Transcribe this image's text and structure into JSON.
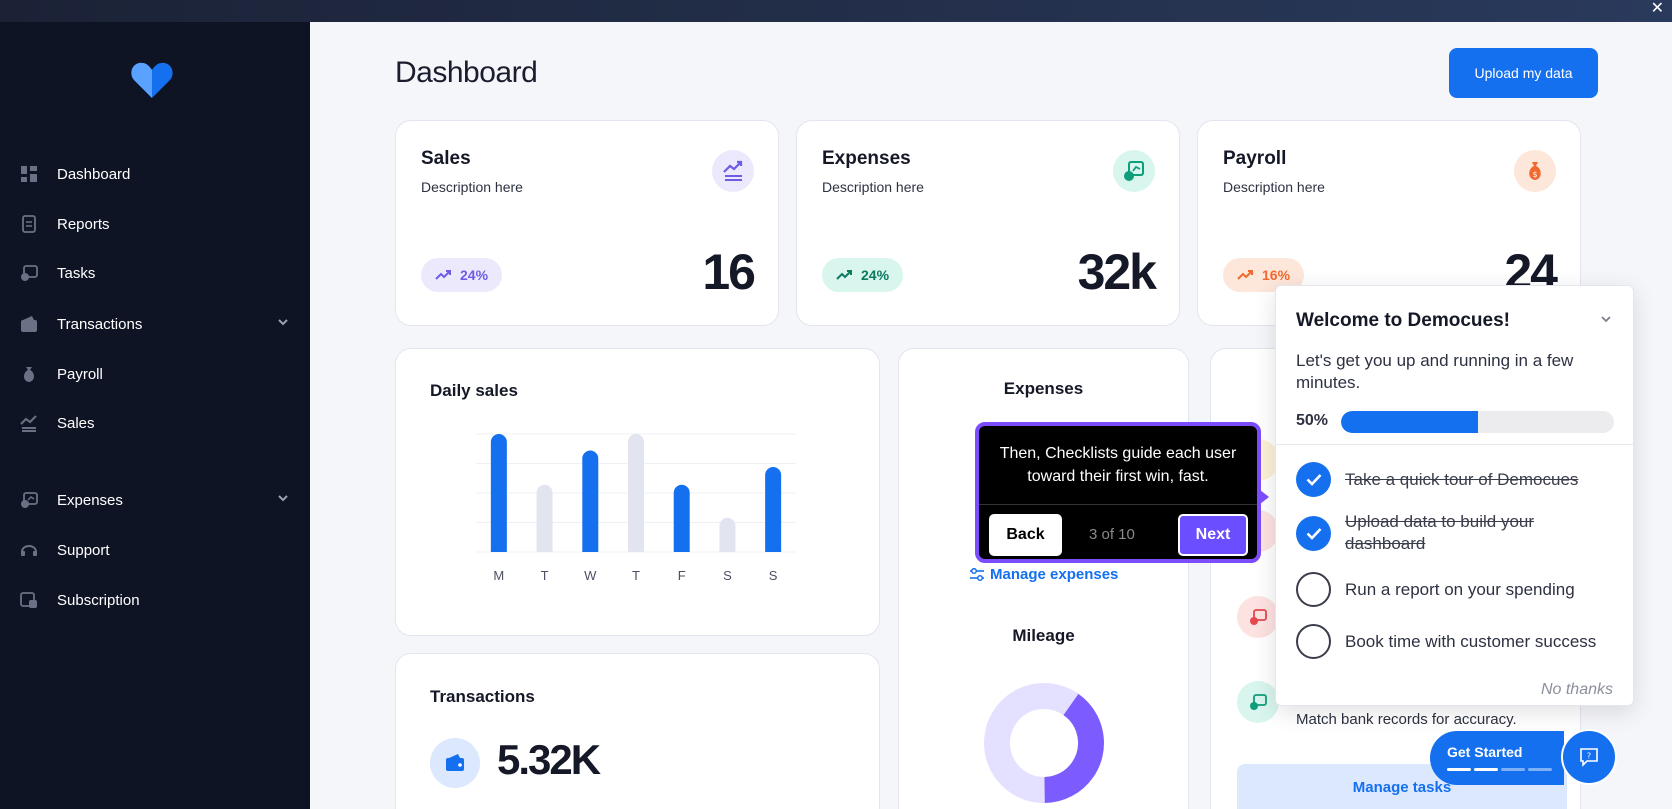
{
  "window": {
    "close_glyph": "✕"
  },
  "sidebar": {
    "logo": "heart-logo",
    "items": [
      {
        "label": "Dashboard",
        "icon": "dashboard-icon"
      },
      {
        "label": "Reports",
        "icon": "document-icon"
      },
      {
        "label": "Tasks",
        "icon": "tasks-icon"
      },
      {
        "label": "Transactions",
        "icon": "wallet-icon"
      },
      {
        "label": "Payroll",
        "icon": "money-bag-icon"
      },
      {
        "label": "Sales",
        "icon": "sales-chart-icon"
      },
      {
        "label": "Expenses",
        "icon": "receipt-icon"
      },
      {
        "label": "Support",
        "icon": "headset-icon"
      },
      {
        "label": "Subscription",
        "icon": "subscription-icon"
      }
    ]
  },
  "header": {
    "title": "Dashboard",
    "upload_label": "Upload my data"
  },
  "kpis": [
    {
      "title": "Sales",
      "description": "Description here",
      "change": "24%",
      "value": "16",
      "color": "#6c5ce7",
      "bg": "#ece9fc"
    },
    {
      "title": "Expenses",
      "description": "Description here",
      "change": "24%",
      "value": "32k",
      "color": "#0f9d7a",
      "bg": "#d8f5ee"
    },
    {
      "title": "Payroll",
      "description": "Description here",
      "change": "16%",
      "value": "24",
      "color": "#f06a2e",
      "bg": "#fde6da"
    }
  ],
  "daily_sales": {
    "title": "Daily sales",
    "chart_data": {
      "type": "bar",
      "categories": [
        "M",
        "T",
        "W",
        "T",
        "F",
        "S",
        "S"
      ],
      "values": [
        100,
        57,
        86,
        100,
        57,
        29,
        72
      ],
      "highlighted": [
        true,
        false,
        true,
        false,
        true,
        false,
        true
      ],
      "ylim": [
        0,
        100
      ],
      "grid": true,
      "colors": {
        "highlight": "#1570ef",
        "muted": "#e2e4ef"
      }
    }
  },
  "expenses_panel": {
    "title": "Expenses",
    "manage_label": "Manage expenses"
  },
  "mileage": {
    "title": "Mileage",
    "chart_data": {
      "type": "pie",
      "values": [
        40,
        60
      ],
      "colors": [
        "#7c5cff",
        "#e4e0ff"
      ]
    }
  },
  "transactions": {
    "title": "Transactions",
    "value": "5.32K"
  },
  "tasks_panel": {
    "match_text": "Match bank records for accuracy.",
    "manage_label": "Manage tasks"
  },
  "tooltip": {
    "text": "Then, Checklists guide each user toward their first win, fast.",
    "back_label": "Back",
    "step": "3 of 10",
    "next_label": "Next"
  },
  "checklist": {
    "title": "Welcome to Democues!",
    "subtitle": "Let's get you up and running in a few minutes.",
    "progress_label": "50%",
    "progress": 0.5,
    "items": [
      {
        "label": "Take a quick tour of Democues",
        "done": true
      },
      {
        "label": "Upload data to build your dashboard",
        "done": true
      },
      {
        "label": "Run a report on your spending",
        "done": false
      },
      {
        "label": "Book time with customer success",
        "done": false
      }
    ],
    "dismiss_label": "No thanks"
  },
  "launcher": {
    "label": "Get Started",
    "steps_done": 2,
    "steps_total": 4
  }
}
